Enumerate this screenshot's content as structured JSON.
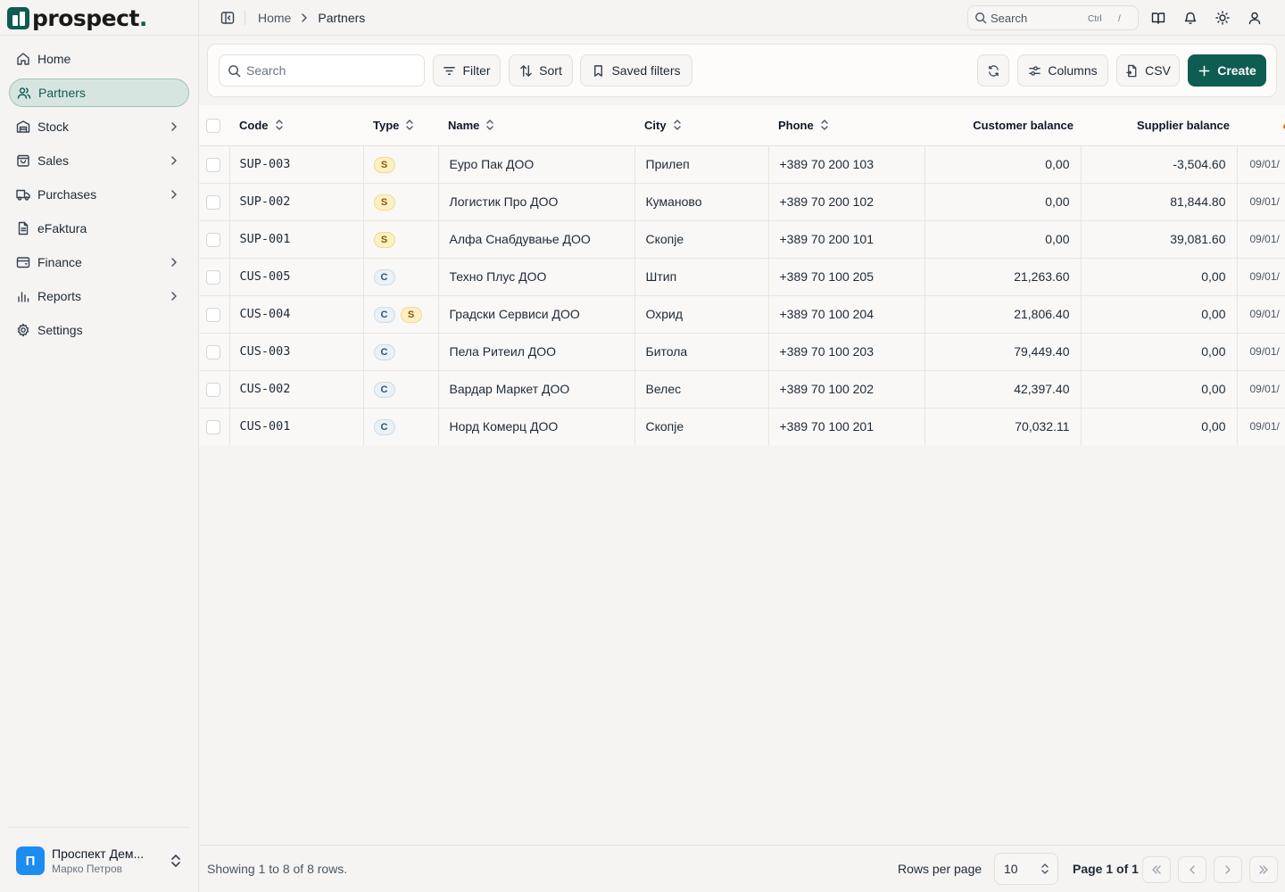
{
  "app": {
    "logo_text": "prospect",
    "logo_dot": "."
  },
  "sidebar": {
    "items": [
      {
        "label": "Home",
        "icon": "home-icon",
        "active": false,
        "expandable": false
      },
      {
        "label": "Partners",
        "icon": "users-icon",
        "active": true,
        "expandable": false
      },
      {
        "label": "Stock",
        "icon": "warehouse-icon",
        "active": false,
        "expandable": true
      },
      {
        "label": "Sales",
        "icon": "shopping-bag-icon",
        "active": false,
        "expandable": true
      },
      {
        "label": "Purchases",
        "icon": "truck-icon",
        "active": false,
        "expandable": true
      },
      {
        "label": "eFaktura",
        "icon": "document-icon",
        "active": false,
        "expandable": false
      },
      {
        "label": "Finance",
        "icon": "wallet-icon",
        "active": false,
        "expandable": true
      },
      {
        "label": "Reports",
        "icon": "bar-chart-icon",
        "active": false,
        "expandable": true
      },
      {
        "label": "Settings",
        "icon": "gear-icon",
        "active": false,
        "expandable": false
      }
    ],
    "user": {
      "avatar_letter": "П",
      "company": "Проспект Дем...",
      "name": "Марко Петров"
    }
  },
  "topbar": {
    "breadcrumb": {
      "home": "Home",
      "current": "Partners"
    },
    "search": {
      "label": "Search",
      "kbd_ctrl": "Ctrl",
      "kbd_key": "/"
    },
    "icons": [
      "book-icon",
      "bell-icon",
      "sun-icon",
      "user-icon"
    ]
  },
  "toolbar": {
    "search_placeholder": "Search",
    "filter_label": "Filter",
    "sort_label": "Sort",
    "saved_filters_label": "Saved filters",
    "columns_label": "Columns",
    "csv_label": "CSV",
    "create_label": "Create"
  },
  "table": {
    "headers": {
      "code": "Code",
      "type": "Type",
      "name": "Name",
      "city": "City",
      "phone": "Phone",
      "customer_balance": "Customer balance",
      "supplier_balance": "Supplier balance"
    },
    "rows": [
      {
        "code": "SUP-003",
        "types": [
          "S"
        ],
        "name": "Еуро Пак ДОО",
        "city": "Прилеп",
        "phone": "+389 70 200 103",
        "customer_balance": "0,00",
        "supplier_balance": "-3,504.60",
        "date": "09/01/"
      },
      {
        "code": "SUP-002",
        "types": [
          "S"
        ],
        "name": "Логистик Про ДОО",
        "city": "Куманово",
        "phone": "+389 70 200 102",
        "customer_balance": "0,00",
        "supplier_balance": "81,844.80",
        "date": "09/01/"
      },
      {
        "code": "SUP-001",
        "types": [
          "S"
        ],
        "name": "Алфа Снабдување ДОО",
        "city": "Скопје",
        "phone": "+389 70 200 101",
        "customer_balance": "0,00",
        "supplier_balance": "39,081.60",
        "date": "09/01/"
      },
      {
        "code": "CUS-005",
        "types": [
          "C"
        ],
        "name": "Техно Плус ДОО",
        "city": "Штип",
        "phone": "+389 70 100 205",
        "customer_balance": "21,263.60",
        "supplier_balance": "0,00",
        "date": "09/01/"
      },
      {
        "code": "CUS-004",
        "types": [
          "C",
          "S"
        ],
        "name": "Градски Сервиси ДОО",
        "city": "Охрид",
        "phone": "+389 70 100 204",
        "customer_balance": "21,806.40",
        "supplier_balance": "0,00",
        "date": "09/01/"
      },
      {
        "code": "CUS-003",
        "types": [
          "C"
        ],
        "name": "Пела Ритеил ДОО",
        "city": "Битола",
        "phone": "+389 70 100 203",
        "customer_balance": "79,449.40",
        "supplier_balance": "0,00",
        "date": "09/01/"
      },
      {
        "code": "CUS-002",
        "types": [
          "C"
        ],
        "name": "Вардар Маркет ДОО",
        "city": "Велес",
        "phone": "+389 70 100 202",
        "customer_balance": "42,397.40",
        "supplier_balance": "0,00",
        "date": "09/01/"
      },
      {
        "code": "CUS-001",
        "types": [
          "C"
        ],
        "name": "Норд Комерц ДОО",
        "city": "Скопје",
        "phone": "+389 70 100 201",
        "customer_balance": "70,032.11",
        "supplier_balance": "0,00",
        "date": "09/01/"
      }
    ]
  },
  "footer": {
    "info": "Showing 1 to 8 of 8 rows.",
    "rows_per_page_label": "Rows per page",
    "rows_per_page_value": "10",
    "page_label": "Page 1 of 1"
  },
  "colors": {
    "brand": "#0f5c52",
    "active_nav_bg": "#d7e5e1",
    "badge_supplier": "#fdf0c4",
    "badge_customer": "#eaf1f7",
    "avatar": "#1d8cf0"
  }
}
